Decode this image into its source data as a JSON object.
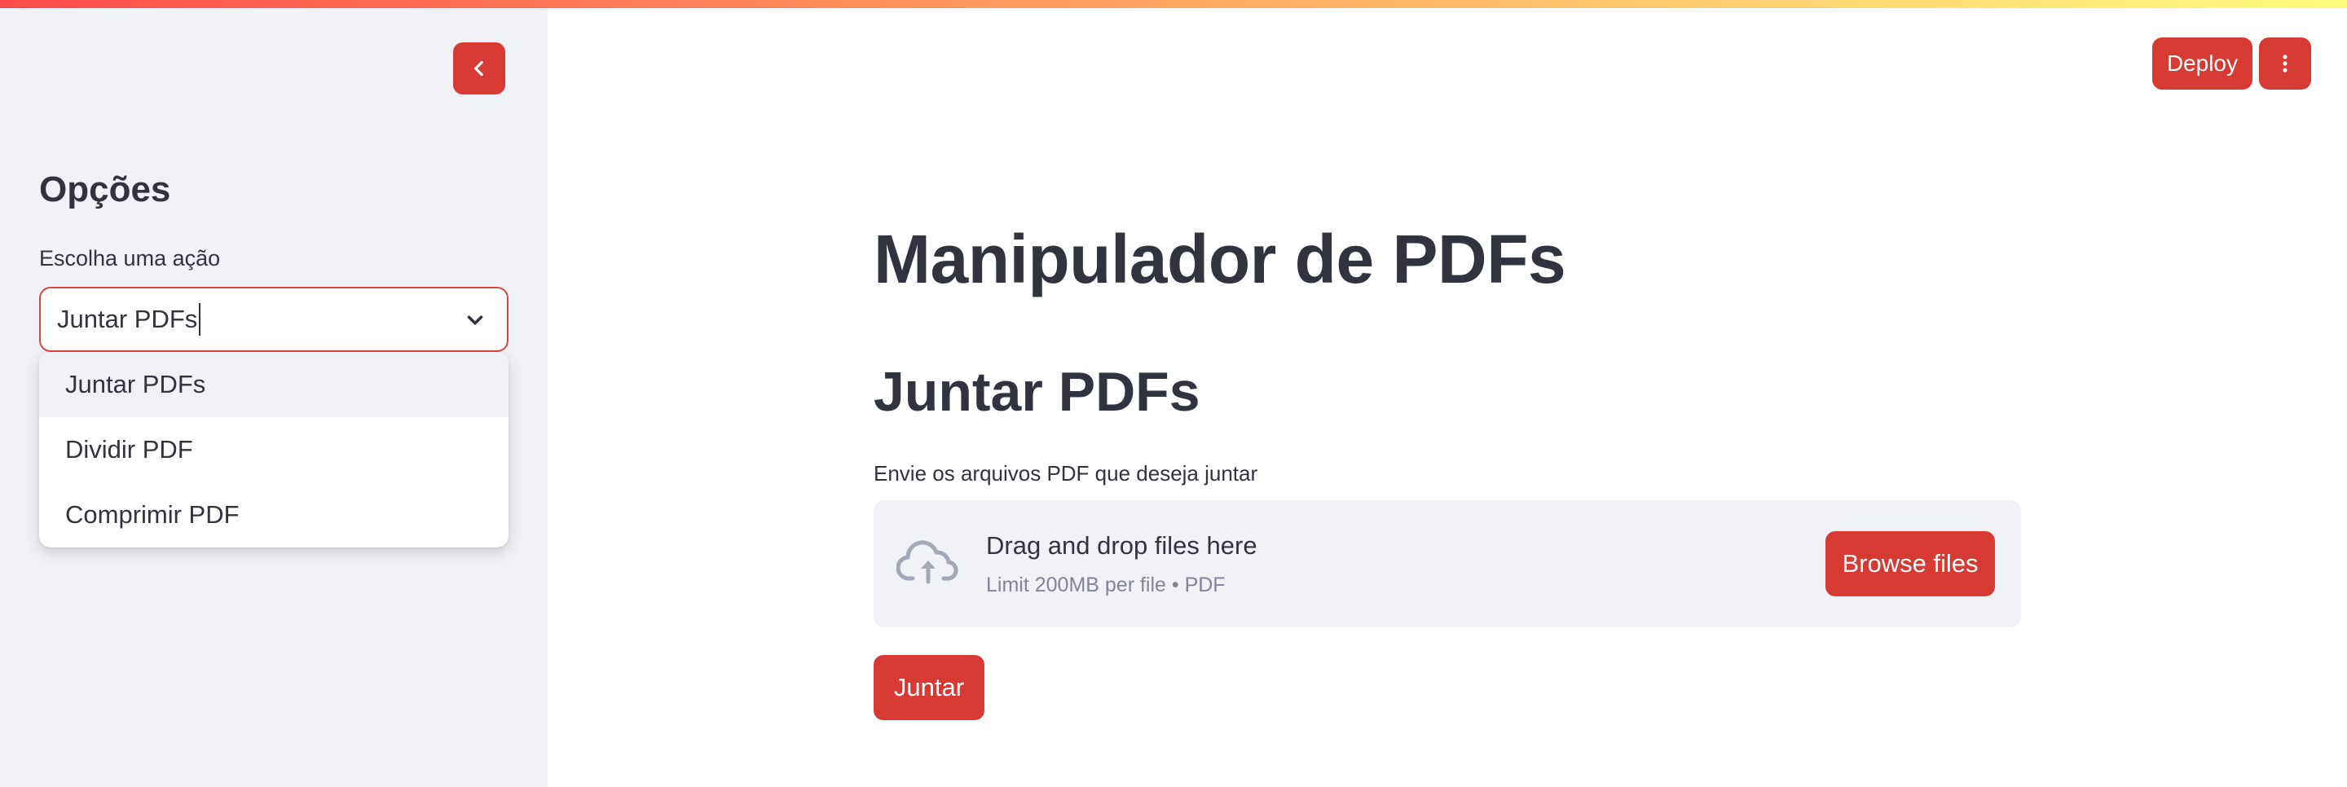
{
  "sidebar": {
    "title": "Opções",
    "select": {
      "label": "Escolha uma ação",
      "value": "Juntar PDFs",
      "options": [
        "Juntar PDFs",
        "Dividir PDF",
        "Comprimir PDF"
      ]
    },
    "collapse_icon": "chevron-left-icon"
  },
  "header": {
    "deploy_label": "Deploy",
    "menu_icon": "more-vertical-icon"
  },
  "main": {
    "title": "Manipulador de PDFs",
    "section_title": "Juntar PDFs",
    "uploader": {
      "label": "Envie os arquivos PDF que deseja juntar",
      "drag_text": "Drag and drop files here",
      "limit_text": "Limit 200MB per file • PDF",
      "browse_label": "Browse files",
      "icon": "cloud-upload-icon"
    },
    "submit_label": "Juntar"
  },
  "colors": {
    "primary": "#d63a33",
    "sidebar_bg": "#f0f2f6",
    "text": "#31333f",
    "muted": "#808495"
  }
}
